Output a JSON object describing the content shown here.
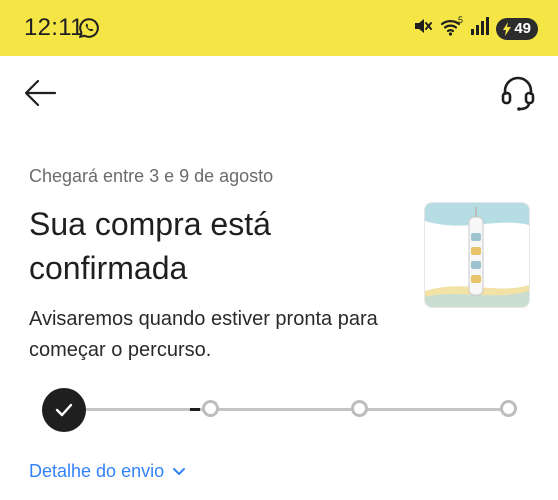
{
  "status_bar": {
    "time": "12:11",
    "battery_level": "49",
    "wifi_label": "5",
    "icons": [
      "whatsapp-icon",
      "mute-icon",
      "wifi-icon",
      "signal-icon",
      "battery-icon"
    ]
  },
  "nav": {
    "back_icon": "arrow-left-icon",
    "help_icon": "headset-icon"
  },
  "order": {
    "eta": "Chegará entre 3 e 9 de agosto",
    "title": "Sua compra está confirmada",
    "subtitle": "Avisaremos quando estiver pronta para começar o percurso.",
    "progress_completed_steps": 1,
    "progress_total_steps": 4
  },
  "shipment": {
    "detail_link": "Detalhe do envio"
  },
  "colors": {
    "status_bar": "#f5e646",
    "link": "#3483fa",
    "step_done": "#1f1f1f",
    "track": "#c4c4c4"
  }
}
